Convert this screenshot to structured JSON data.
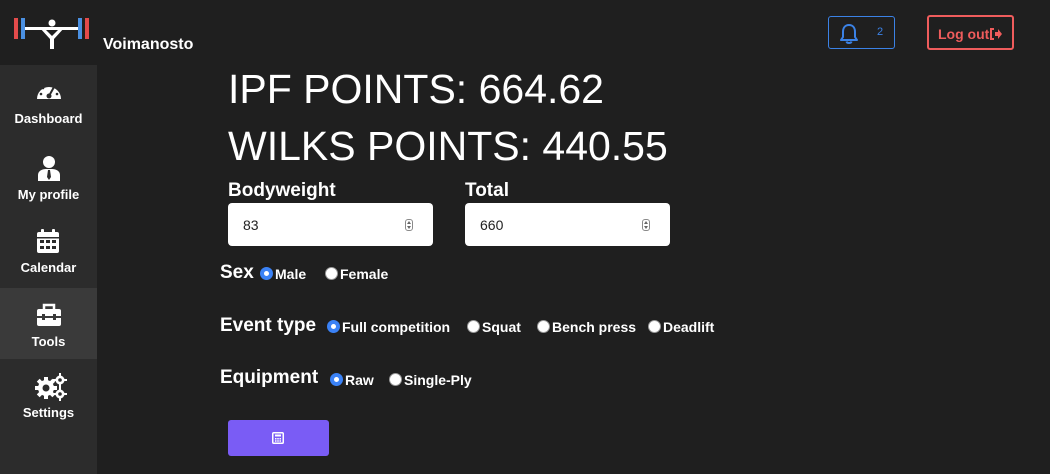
{
  "header": {
    "brand": "Voimanosto",
    "notifications": {
      "count": "2",
      "icon": "bell-icon"
    },
    "logout_label": "Log out",
    "colors": {
      "notification": "#3b82e6",
      "logout": "#ef5c5c",
      "accent": "#7a5cf5"
    }
  },
  "sidebar": {
    "items": [
      {
        "label": "Dashboard",
        "icon": "gauge-icon",
        "active": false
      },
      {
        "label": "My profile",
        "icon": "user-tie-icon",
        "active": false
      },
      {
        "label": "Calendar",
        "icon": "calendar-icon",
        "active": false
      },
      {
        "label": "Tools",
        "icon": "toolbox-icon",
        "active": true
      },
      {
        "label": "Settings",
        "icon": "gears-icon",
        "active": false
      }
    ]
  },
  "main": {
    "ipf_points": "IPF POINTS: 664.62",
    "wilks_points": "WILKS POINTS: 440.55",
    "bodyweight": {
      "label": "Bodyweight",
      "value": "83"
    },
    "total": {
      "label": "Total",
      "value": "660"
    },
    "sex": {
      "title": "Sex",
      "options": [
        {
          "label": "Male",
          "checked": true
        },
        {
          "label": "Female",
          "checked": false
        }
      ]
    },
    "event_type": {
      "title": "Event type",
      "options": [
        {
          "label": "Full competition",
          "checked": true
        },
        {
          "label": "Squat",
          "checked": false
        },
        {
          "label": "Bench press",
          "checked": false
        },
        {
          "label": "Deadlift",
          "checked": false
        }
      ]
    },
    "equipment": {
      "title": "Equipment",
      "options": [
        {
          "label": "Raw",
          "checked": true
        },
        {
          "label": "Single-Ply",
          "checked": false
        }
      ]
    },
    "calculate_icon": "calculator-icon"
  }
}
